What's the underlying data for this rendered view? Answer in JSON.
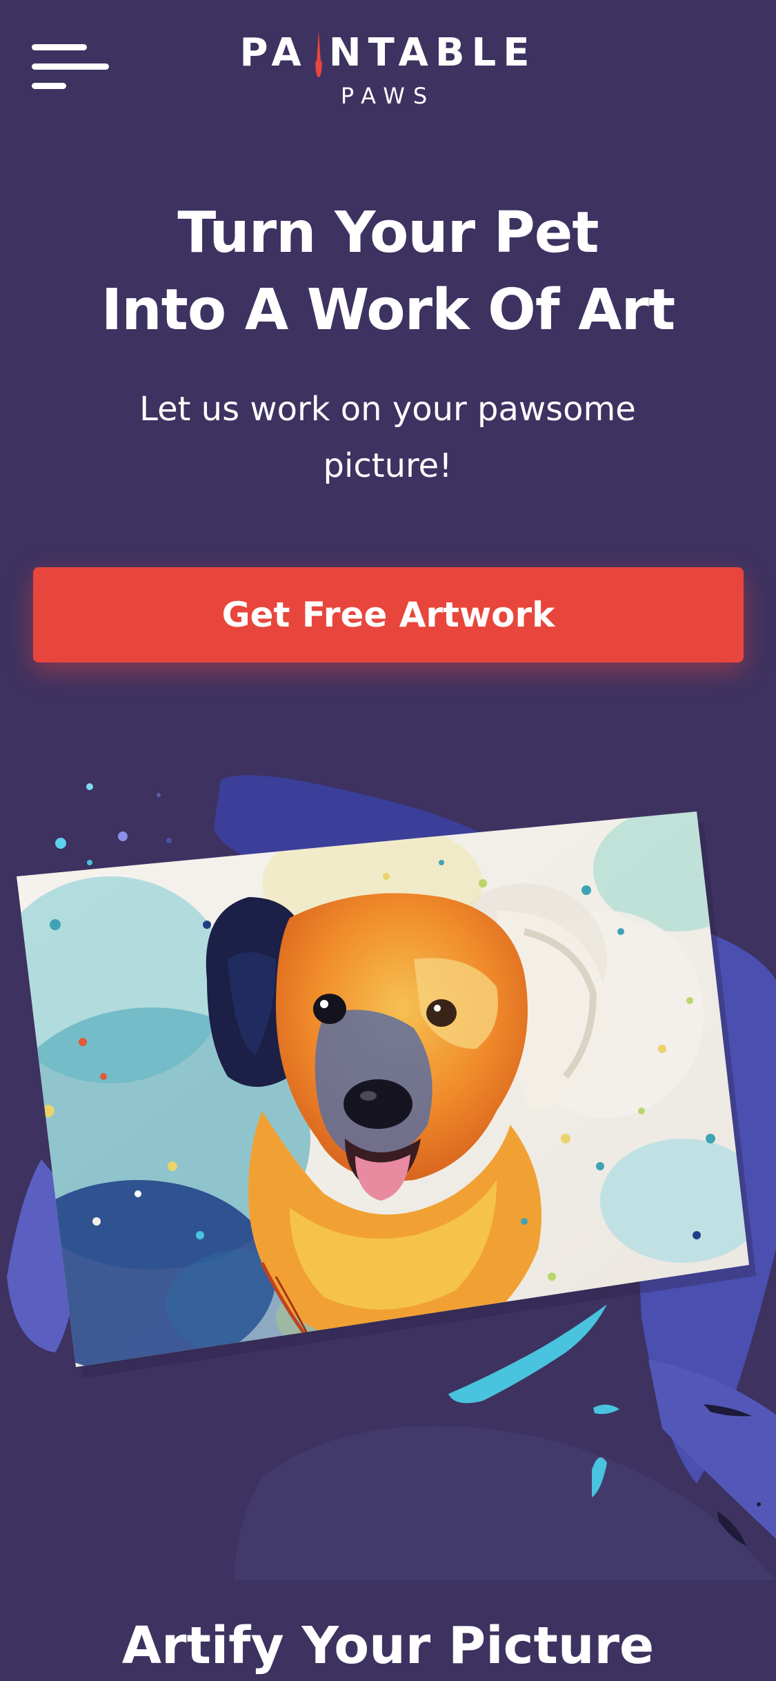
{
  "brand": {
    "name_left": "PA",
    "name_right": "NTABLE",
    "name_sub": "PAWS",
    "accent": "#e8463c"
  },
  "header": {
    "menu_icon": "hamburger-menu-icon"
  },
  "hero": {
    "title_line1": "Turn Your Pet",
    "title_line2": "Into A Work Of Art",
    "subtitle": "Let us work on your pawsome picture!"
  },
  "cta": {
    "label": "Get Free Artwork",
    "color": "#e8463c"
  },
  "artwork": {
    "subject": "watercolor-dog-portrait"
  },
  "section": {
    "title": "Artify Your Picture"
  },
  "colors": {
    "background": "#3d3260",
    "blob_blue": "#3b3f9a",
    "blob_periwinkle": "#5a5fc0",
    "splash_teal": "#49c3de"
  }
}
